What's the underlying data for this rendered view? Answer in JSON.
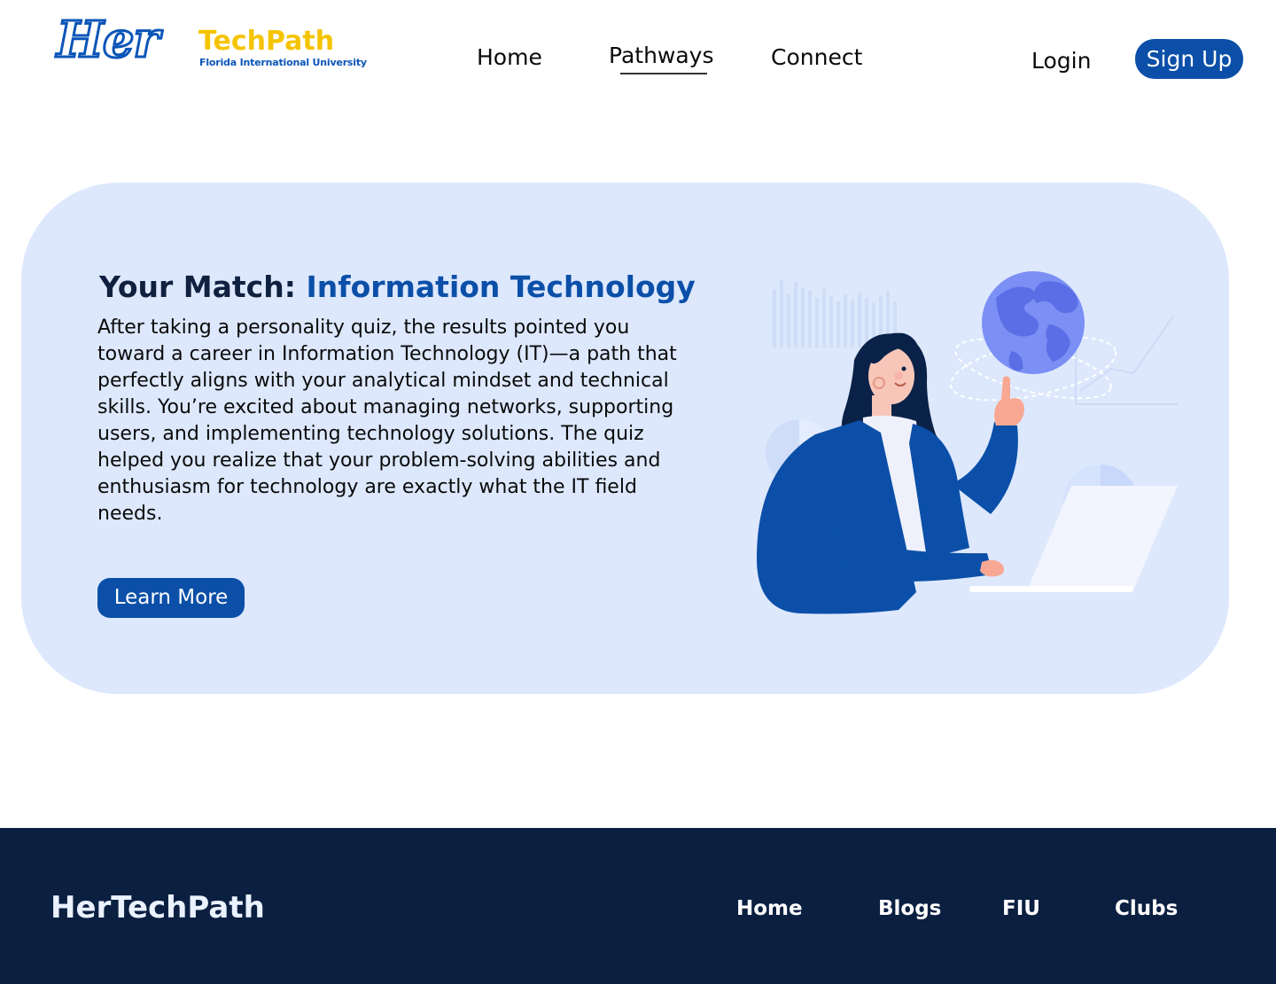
{
  "header": {
    "logo": {
      "script": "Her",
      "name": "TechPath",
      "subtitle": "Florida International University"
    },
    "nav": [
      {
        "label": "Home"
      },
      {
        "label": "Pathways",
        "active": true
      },
      {
        "label": "Connect"
      }
    ],
    "login_label": "Login",
    "signup_label": "Sign Up"
  },
  "hero": {
    "title_prefix": "Your Match:",
    "title_accent": "Information Technology",
    "description": "After taking a personality quiz, the results pointed you toward a career in Information Technology (IT)—a path that perfectly aligns with your analytical mindset and technical skills. You’re excited about managing networks, supporting users, and implementing technology solutions. The quiz helped you realize that your problem-solving abilities and enthusiasm for technology are exactly what the IT field needs.",
    "button_label": "Learn More",
    "illustration": "woman-with-globe-and-laptop-illustration"
  },
  "footer": {
    "brand": "HerTechPath",
    "links": [
      "Home",
      "Blogs",
      "FIU",
      "Clubs"
    ]
  },
  "colors": {
    "primary": "#0b4fa8",
    "hero_bg": "#dde8fd",
    "footer_bg": "#0b1f40",
    "logo_yellow": "#f5c400"
  }
}
